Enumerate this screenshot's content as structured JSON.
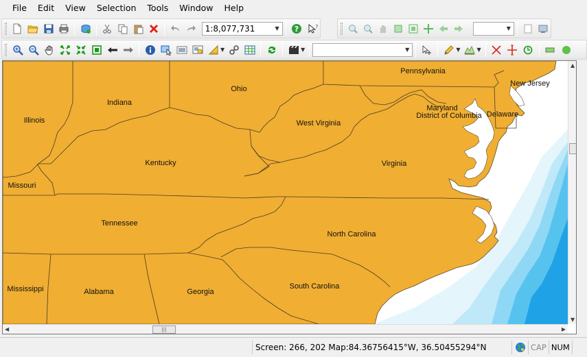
{
  "menu": [
    "File",
    "Edit",
    "View",
    "Selection",
    "Tools",
    "Window",
    "Help"
  ],
  "toolbar1": {
    "scale_value": "1:8,077,731",
    "icons": [
      "new-document-icon",
      "open-folder-icon",
      "save-icon",
      "print-icon",
      "add-data-icon",
      "cut-icon",
      "copy-icon",
      "paste-icon",
      "delete-icon",
      "undo-icon",
      "redo-icon"
    ],
    "right_icons": [
      "help-icon",
      "whats-this-icon"
    ]
  },
  "toolbar2": {
    "icons": [
      "zoom-in-fixed-icon",
      "zoom-out-fixed-icon",
      "pan-hand-icon",
      "full-extent-icon",
      "zoom-to-layer-icon",
      "center-icon",
      "back-extent-icon",
      "forward-extent-icon"
    ],
    "combo_value": "",
    "trailing_icons": [
      "layout-page-icon",
      "layout-view-icon"
    ]
  },
  "toolbar3": {
    "icons": [
      "zoom-in-icon",
      "zoom-out-icon",
      "pan-icon",
      "fixed-zoom-in-icon",
      "fixed-zoom-out-icon",
      "full-extent-icon",
      "back-icon",
      "forward-icon",
      "identify-icon",
      "select-features-icon",
      "hyperlink-icon",
      "html-popup-icon",
      "measure-icon",
      "connect-icon",
      "table-icon",
      "refresh-icon",
      "movie-icon"
    ],
    "layer_combo_value": "",
    "edit_icons": [
      "edit-tool-icon",
      "sketch-pencil-icon",
      "construct-icon",
      "cut-polygon-icon",
      "split-icon",
      "rotate-icon",
      "attributes-icon",
      "circle-icon"
    ]
  },
  "map": {
    "land_color": "#f0ae33",
    "ocean_colors": [
      "#e4f5fc",
      "#bfe9f9",
      "#8fd8f5",
      "#56c3ef",
      "#1fa3e6"
    ],
    "states": [
      {
        "name": "Pennsylvania"
      },
      {
        "name": "Ohio"
      },
      {
        "name": "New Jersey"
      },
      {
        "name": "Indiana"
      },
      {
        "name": "Illinois"
      },
      {
        "name": "Maryland"
      },
      {
        "name": "District of Columbia"
      },
      {
        "name": "Delaware"
      },
      {
        "name": "West Virginia"
      },
      {
        "name": "Kentucky"
      },
      {
        "name": "Virginia"
      },
      {
        "name": "Missouri"
      },
      {
        "name": "Tennessee"
      },
      {
        "name": "North Carolina"
      },
      {
        "name": "Mississippi"
      },
      {
        "name": "Alabama"
      },
      {
        "name": "Georgia"
      },
      {
        "name": "South Carolina"
      }
    ]
  },
  "status": {
    "coords": "Screen: 266, 202  Map:84.36756415°W, 36.50455294°N",
    "cap": "CAP",
    "num": "NUM"
  }
}
